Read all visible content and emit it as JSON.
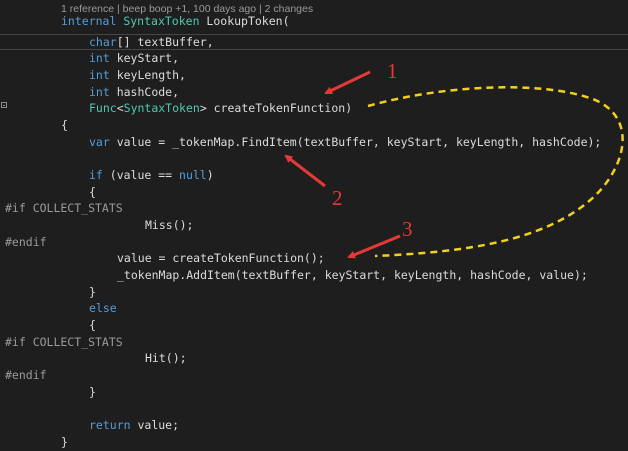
{
  "codelens": "1 reference | beep boop +1, 100 days ago | 2 changes",
  "code": {
    "l1_kw": "internal",
    "l1_ty": "SyntaxToken",
    "l1_rest": " LookupToken(",
    "l2_kw": "char",
    "l2_rest": "[] textBuffer,",
    "l3_kw": "int",
    "l3_rest": " keyStart,",
    "l4_kw": "int",
    "l4_rest": " keyLength,",
    "l5_kw": "int",
    "l5_rest": " hashCode,",
    "l6_ty1": "Func",
    "l6_p1": "<",
    "l6_ty2": "SyntaxToken",
    "l6_rest": "> createTokenFunction)",
    "l7": "{",
    "l8_kw": "var",
    "l8_rest": " value = _tokenMap.FindItem(textBuffer, keyStart, keyLength, hashCode);",
    "l9_kw": "if",
    "l9_mid": " (value == ",
    "l9_kw2": "null",
    "l9_end": ")",
    "l10": "{",
    "l11": "#if COLLECT_STATS",
    "l12": "Miss();",
    "l13": "#endif",
    "l14": "value = createTokenFunction();",
    "l15": "_tokenMap.AddItem(textBuffer, keyStart, keyLength, hashCode, value);",
    "l16": "}",
    "l17_kw": "else",
    "l18": "{",
    "l19": "#if COLLECT_STATS",
    "l20": "Hit();",
    "l21": "#endif",
    "l22": "}",
    "l23_kw": "return",
    "l23_rest": " value;",
    "l24": "}"
  },
  "annotations": {
    "label1": "1",
    "label2": "2",
    "label3": "3",
    "arrow_color": "#e53935",
    "dash_color": "#f2d01e"
  },
  "colors": {
    "background": "#1e1e1e",
    "keyword": "#569cd6",
    "type": "#4ec9b0",
    "text": "#dcdcdc",
    "preprocessor": "#9b9b9b"
  }
}
